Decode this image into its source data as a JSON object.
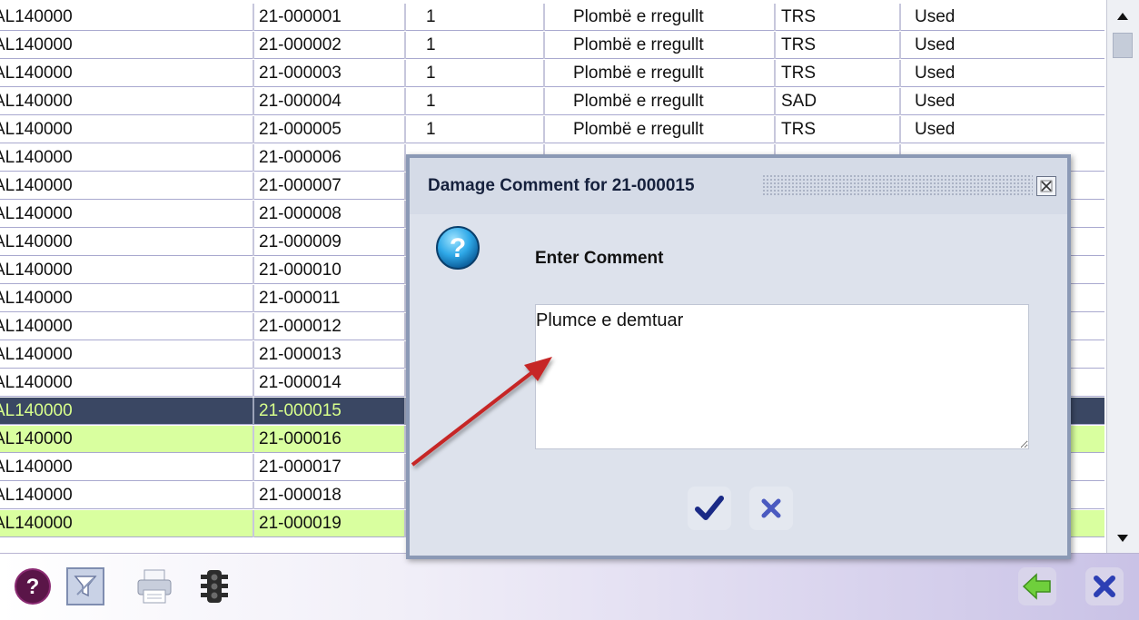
{
  "columns_visible": [
    "lot",
    "seal_number",
    "qty",
    "status",
    "document_type",
    "usage"
  ],
  "rows": [
    {
      "lot": "AL140000",
      "seal": "21-000001",
      "qty": "1",
      "status": "Plombë e rregullt",
      "doc": "TRS",
      "usage": "Used"
    },
    {
      "lot": "AL140000",
      "seal": "21-000002",
      "qty": "1",
      "status": "Plombë e rregullt",
      "doc": "TRS",
      "usage": "Used"
    },
    {
      "lot": "AL140000",
      "seal": "21-000003",
      "qty": "1",
      "status": "Plombë e rregullt",
      "doc": "TRS",
      "usage": "Used"
    },
    {
      "lot": "AL140000",
      "seal": "21-000004",
      "qty": "1",
      "status": "Plombë e rregullt",
      "doc": "SAD",
      "usage": "Used"
    },
    {
      "lot": "AL140000",
      "seal": "21-000005",
      "qty": "1",
      "status": "Plombë e rregullt",
      "doc": "TRS",
      "usage": "Used"
    },
    {
      "lot": "AL140000",
      "seal": "21-000006",
      "qty": "",
      "status": "",
      "doc": "",
      "usage": ""
    },
    {
      "lot": "AL140000",
      "seal": "21-000007",
      "qty": "",
      "status": "",
      "doc": "",
      "usage": ""
    },
    {
      "lot": "AL140000",
      "seal": "21-000008",
      "qty": "",
      "status": "",
      "doc": "",
      "usage": ""
    },
    {
      "lot": "AL140000",
      "seal": "21-000009",
      "qty": "",
      "status": "",
      "doc": "",
      "usage": ""
    },
    {
      "lot": "AL140000",
      "seal": "21-000010",
      "qty": "",
      "status": "",
      "doc": "",
      "usage": ""
    },
    {
      "lot": "AL140000",
      "seal": "21-000011",
      "qty": "",
      "status": "",
      "doc": "",
      "usage": ""
    },
    {
      "lot": "AL140000",
      "seal": "21-000012",
      "qty": "",
      "status": "",
      "doc": "",
      "usage": ""
    },
    {
      "lot": "AL140000",
      "seal": "21-000013",
      "qty": "",
      "status": "",
      "doc": "",
      "usage": ""
    },
    {
      "lot": "AL140000",
      "seal": "21-000014",
      "qty": "",
      "status": "",
      "doc": "",
      "usage": ""
    },
    {
      "lot": "AL140000",
      "seal": "21-000015",
      "qty": "",
      "status": "",
      "doc": "",
      "usage": "",
      "state": "selected"
    },
    {
      "lot": "AL140000",
      "seal": "21-000016",
      "qty": "",
      "status": "",
      "doc": "",
      "usage": "",
      "state": "highlight"
    },
    {
      "lot": "AL140000",
      "seal": "21-000017",
      "qty": "",
      "status": "",
      "doc": "",
      "usage": ""
    },
    {
      "lot": "AL140000",
      "seal": "21-000018",
      "qty": "",
      "status": "",
      "doc": "",
      "usage": ""
    },
    {
      "lot": "AL140000",
      "seal": "21-000019",
      "qty": "",
      "status": "",
      "doc": "",
      "usage": "",
      "state": "highlight"
    }
  ],
  "dialog": {
    "title": "Damage Comment for 21-000015",
    "prompt": "Enter Comment",
    "comment_value": "Plumce e demtuar",
    "ok_icon": "checkmark-icon",
    "cancel_icon": "x-icon"
  },
  "toolbar": {
    "left_icons": [
      "help-icon",
      "filter-clear-icon",
      "printer-icon",
      "traffic-light-icon"
    ],
    "right_icons": [
      "back-arrow-icon",
      "close-x-icon"
    ]
  },
  "colors": {
    "selected_row_bg": "#3a4763",
    "selected_row_text": "#d8ff8c",
    "highlight_row_bg": "#d9ff9f",
    "dialog_bg": "#dde2ec",
    "annotation_arrow": "#c62828"
  }
}
